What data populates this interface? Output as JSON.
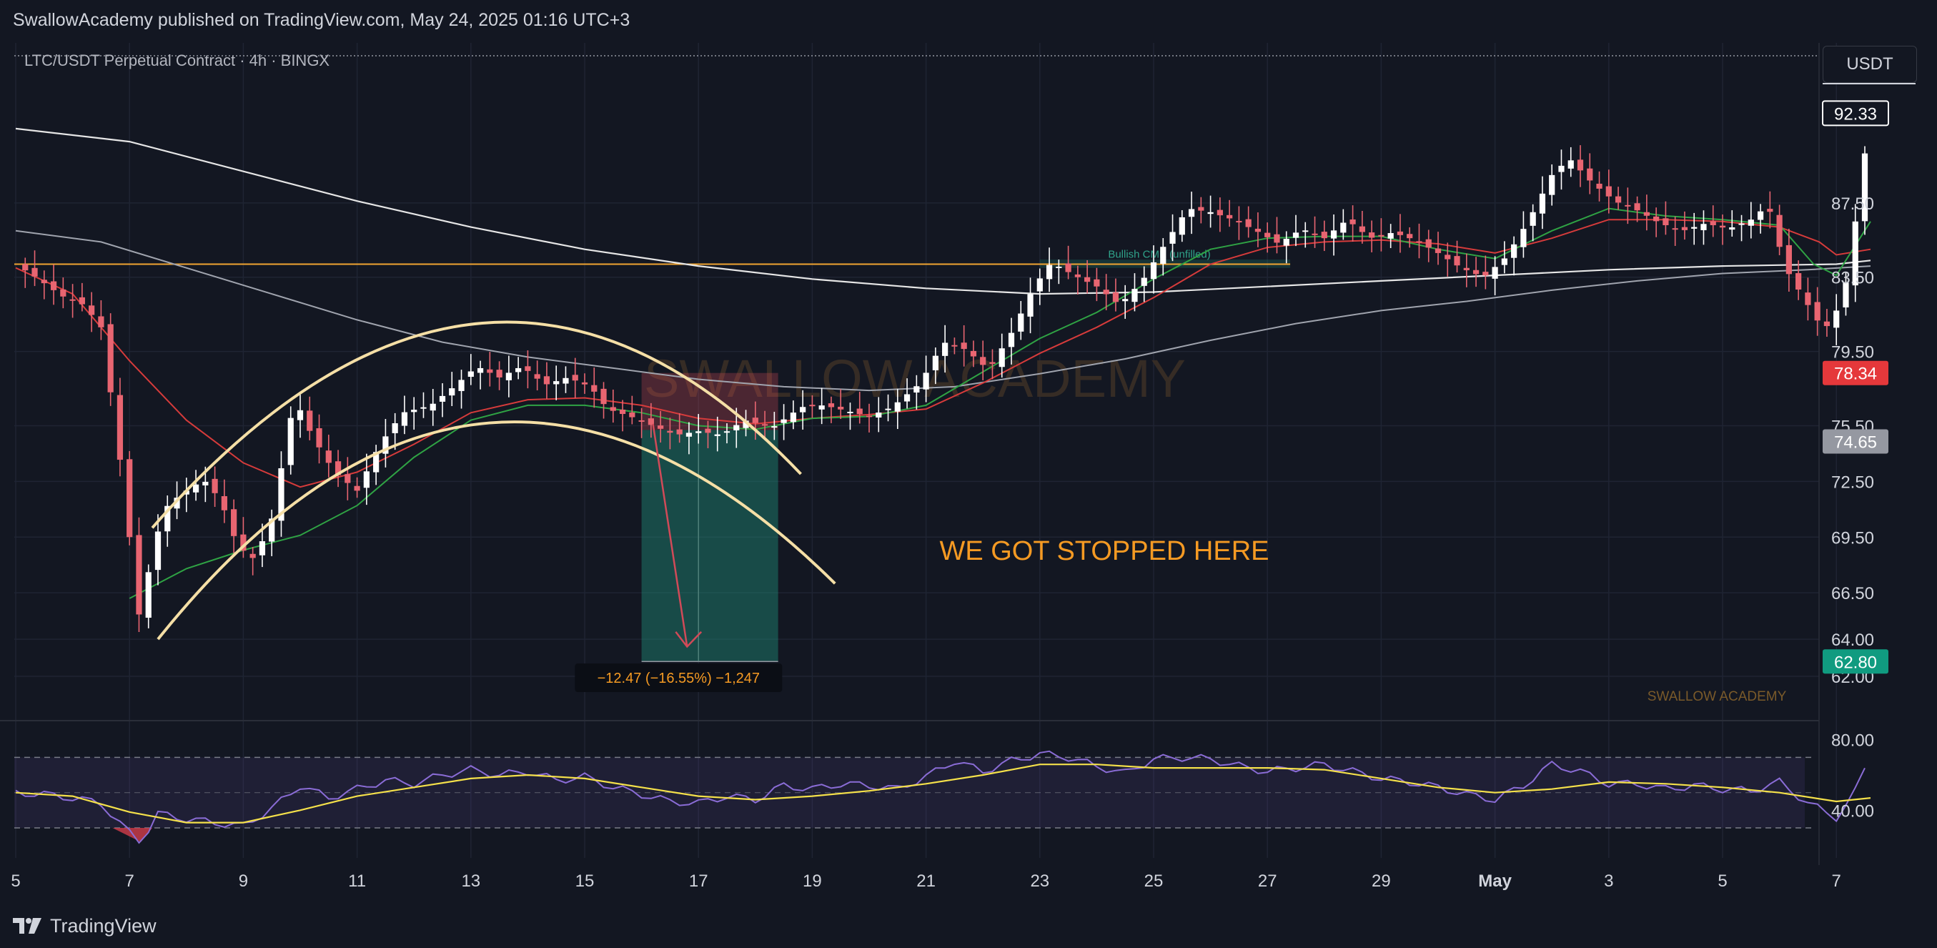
{
  "header": {
    "publisher_line": "SwallowAcademy published on TradingView.com, May 24, 2025 01:16 UTC+3",
    "symbol_line": "LTC/USDT Perpetual Contract · 4h · BINGX",
    "currency_button": "USDT"
  },
  "footer": {
    "brand": "TradingView"
  },
  "colors": {
    "background": "#131722",
    "bull": "#ffffff",
    "bear": "#e86571",
    "ema_fast": "#2fa344",
    "ema_mid": "#d63b3b",
    "ma_slow_1": "#e6e6e6",
    "ma_slow_2": "#a0a4ae",
    "resistance": "#f2a531",
    "rsi": "#8a6cd6",
    "rsi_ma": "#f5e14a",
    "arcs": "#f5dfa6",
    "annotation": "#f59a23",
    "stop_box": "#e0505e",
    "target_box": "#1f8c78"
  },
  "chart_data": {
    "type": "candlestick",
    "timeframe": "4h",
    "x_ticks": [
      "5",
      "7",
      "9",
      "11",
      "13",
      "15",
      "17",
      "19",
      "21",
      "23",
      "25",
      "27",
      "29",
      "May",
      "3",
      "5",
      "7"
    ],
    "price_ticks": [
      87.5,
      83.5,
      79.5,
      75.5,
      72.5,
      69.5,
      66.5,
      64.0,
      62.0
    ],
    "price_ticks_labels": [
      "87.50",
      "83.50",
      "79.50",
      "75.50",
      "72.50",
      "69.50",
      "66.50",
      "64.00",
      "62.00"
    ],
    "price_range": [
      60.5,
      93.5
    ],
    "price_badges": [
      {
        "label": "92.33",
        "value": 92.33,
        "bg": "#131722",
        "fg": "#ffffff",
        "border": "#ffffff"
      },
      {
        "label": "78.34",
        "value": 78.34,
        "bg": "#e5383b",
        "fg": "#ffffff",
        "border": ""
      },
      {
        "label": "74.65",
        "value": 74.65,
        "bg": "#9598a1",
        "fg": "#ffffff",
        "border": ""
      },
      {
        "label": "62.80",
        "value": 62.8,
        "bg": "#109b80",
        "fg": "#ffffff",
        "border": ""
      }
    ],
    "resistance_level": 84.2,
    "close_price": 92.33,
    "annotations": {
      "callout": "WE GOT STOPPED HERE",
      "cme_gap": "Bullish CME (unfilled)",
      "watermark": "SWALLOW ACADEMY",
      "small_brand": "SWALLOW ACADEMY",
      "trade_result": "−12.47 (−16.55%) −1,247"
    },
    "short_position": {
      "entry": 75.27,
      "stop": 78.34,
      "target": 62.8,
      "start_day": 16.0,
      "end_day": 18.4
    },
    "rsi": {
      "ticks": [
        80,
        40
      ],
      "ticks_labels": [
        "80.00",
        "40.00"
      ],
      "upper": 70,
      "lower": 30,
      "range": [
        15,
        90
      ]
    },
    "series_keypoints": {
      "price": [
        [
          5.0,
          84.2
        ],
        [
          5.4,
          83.4
        ],
        [
          5.8,
          82.5
        ],
        [
          6.2,
          82.0
        ],
        [
          6.5,
          80.8
        ],
        [
          6.8,
          74.5
        ],
        [
          7.0,
          69.5
        ],
        [
          7.2,
          64.5
        ],
        [
          7.35,
          68.0
        ],
        [
          7.6,
          71.0
        ],
        [
          7.9,
          71.8
        ],
        [
          8.3,
          72.6
        ],
        [
          8.6,
          71.5
        ],
        [
          8.9,
          69.0
        ],
        [
          9.2,
          68.3
        ],
        [
          9.5,
          70.5
        ],
        [
          9.9,
          77.0
        ],
        [
          10.2,
          75.0
        ],
        [
          10.6,
          73.0
        ],
        [
          11.0,
          72.0
        ],
        [
          11.4,
          74.5
        ],
        [
          11.8,
          76.2
        ],
        [
          12.3,
          76.6
        ],
        [
          12.7,
          77.6
        ],
        [
          13.1,
          78.7
        ],
        [
          13.5,
          78.1
        ],
        [
          13.9,
          78.7
        ],
        [
          14.3,
          77.7
        ],
        [
          14.7,
          78.1
        ],
        [
          15.1,
          77.6
        ],
        [
          15.4,
          76.4
        ],
        [
          15.8,
          76.0
        ],
        [
          16.2,
          75.5
        ],
        [
          16.6,
          75.0
        ],
        [
          17.0,
          75.2
        ],
        [
          17.4,
          75.0
        ],
        [
          17.8,
          75.8
        ],
        [
          18.3,
          75.4
        ],
        [
          18.8,
          76.5
        ],
        [
          19.2,
          76.6
        ],
        [
          19.6,
          76.3
        ],
        [
          20.0,
          76.0
        ],
        [
          20.4,
          76.5
        ],
        [
          20.9,
          77.8
        ],
        [
          21.3,
          80.0
        ],
        [
          21.7,
          79.6
        ],
        [
          22.1,
          78.5
        ],
        [
          22.5,
          80.5
        ],
        [
          22.9,
          83.0
        ],
        [
          23.2,
          84.3
        ],
        [
          23.6,
          83.6
        ],
        [
          24.0,
          83.0
        ],
        [
          24.4,
          82.0
        ],
        [
          24.8,
          83.3
        ],
        [
          25.2,
          85.3
        ],
        [
          25.6,
          87.2
        ],
        [
          26.0,
          87.0
        ],
        [
          26.4,
          86.6
        ],
        [
          26.8,
          86.0
        ],
        [
          27.2,
          85.3
        ],
        [
          27.6,
          86.1
        ],
        [
          28.0,
          85.6
        ],
        [
          28.4,
          86.6
        ],
        [
          28.8,
          85.6
        ],
        [
          29.2,
          85.9
        ],
        [
          29.6,
          85.5
        ],
        [
          30.0,
          84.8
        ],
        [
          30.4,
          84.0
        ],
        [
          30.8,
          83.5
        ],
        [
          31.2,
          84.6
        ],
        [
          31.6,
          86.6
        ],
        [
          32.0,
          89.0
        ],
        [
          32.3,
          89.9
        ],
        [
          32.7,
          88.6
        ],
        [
          33.1,
          87.6
        ],
        [
          33.5,
          87.1
        ],
        [
          33.9,
          86.4
        ],
        [
          34.3,
          86.0
        ],
        [
          34.7,
          86.4
        ],
        [
          35.1,
          86.1
        ],
        [
          35.5,
          86.6
        ],
        [
          35.8,
          87.4
        ],
        [
          36.1,
          84.0
        ],
        [
          36.4,
          82.5
        ],
        [
          36.7,
          81.0
        ],
        [
          36.9,
          80.8
        ],
        [
          37.2,
          83.5
        ],
        [
          37.4,
          88.0
        ],
        [
          37.6,
          92.33
        ]
      ],
      "ema_fast": [
        [
          7.0,
          66.2
        ],
        [
          8.0,
          67.8
        ],
        [
          9.0,
          68.8
        ],
        [
          10.0,
          69.6
        ],
        [
          11.0,
          71.2
        ],
        [
          12.0,
          73.8
        ],
        [
          13.0,
          75.8
        ],
        [
          14.0,
          76.6
        ],
        [
          15.0,
          76.6
        ],
        [
          16.0,
          76.2
        ],
        [
          17.0,
          75.5
        ],
        [
          18.0,
          75.3
        ],
        [
          19.0,
          75.9
        ],
        [
          20.0,
          76.0
        ],
        [
          21.0,
          76.6
        ],
        [
          22.0,
          78.4
        ],
        [
          23.0,
          80.2
        ],
        [
          24.0,
          81.6
        ],
        [
          25.0,
          83.4
        ],
        [
          26.0,
          85.0
        ],
        [
          27.0,
          85.6
        ],
        [
          28.0,
          85.7
        ],
        [
          29.0,
          85.7
        ],
        [
          30.0,
          85.0
        ],
        [
          31.0,
          84.5
        ],
        [
          32.0,
          86.0
        ],
        [
          33.0,
          87.2
        ],
        [
          34.0,
          86.8
        ],
        [
          35.0,
          86.6
        ],
        [
          36.0,
          86.3
        ],
        [
          36.6,
          84.2
        ],
        [
          37.0,
          83.6
        ],
        [
          37.6,
          86.5
        ]
      ],
      "ema_mid": [
        [
          5.0,
          84.0
        ],
        [
          6.0,
          82.6
        ],
        [
          7.0,
          79.0
        ],
        [
          8.0,
          75.8
        ],
        [
          9.0,
          73.5
        ],
        [
          10.0,
          72.2
        ],
        [
          11.0,
          73.0
        ],
        [
          12.0,
          74.5
        ],
        [
          13.0,
          76.2
        ],
        [
          14.0,
          76.9
        ],
        [
          15.0,
          77.0
        ],
        [
          16.0,
          76.6
        ],
        [
          17.0,
          75.9
        ],
        [
          18.0,
          75.6
        ],
        [
          19.0,
          75.9
        ],
        [
          20.0,
          76.1
        ],
        [
          21.0,
          76.4
        ],
        [
          22.0,
          77.8
        ],
        [
          23.0,
          79.4
        ],
        [
          24.0,
          80.8
        ],
        [
          25.0,
          82.4
        ],
        [
          26.0,
          84.2
        ],
        [
          27.0,
          85.1
        ],
        [
          28.0,
          85.4
        ],
        [
          29.0,
          85.5
        ],
        [
          30.0,
          85.3
        ],
        [
          31.0,
          84.8
        ],
        [
          32.0,
          85.6
        ],
        [
          33.0,
          86.6
        ],
        [
          34.0,
          86.6
        ],
        [
          35.0,
          86.5
        ],
        [
          36.0,
          86.2
        ],
        [
          36.7,
          85.4
        ],
        [
          37.0,
          84.7
        ],
        [
          37.6,
          85.0
        ]
      ],
      "ma_slow_1": [
        [
          5.0,
          91.5
        ],
        [
          7.0,
          90.8
        ],
        [
          9.0,
          89.2
        ],
        [
          11.0,
          87.6
        ],
        [
          13.0,
          86.2
        ],
        [
          15.0,
          85.0
        ],
        [
          17.0,
          84.1
        ],
        [
          19.0,
          83.4
        ],
        [
          21.0,
          82.9
        ],
        [
          23.0,
          82.6
        ],
        [
          25.0,
          82.7
        ],
        [
          27.0,
          83.0
        ],
        [
          29.0,
          83.3
        ],
        [
          31.0,
          83.6
        ],
        [
          33.0,
          83.9
        ],
        [
          35.0,
          84.1
        ],
        [
          37.0,
          84.2
        ],
        [
          37.6,
          84.4
        ]
      ],
      "ma_slow_2": [
        [
          5.0,
          86.0
        ],
        [
          6.5,
          85.4
        ],
        [
          8.0,
          84.0
        ],
        [
          9.5,
          82.6
        ],
        [
          11.0,
          81.2
        ],
        [
          12.5,
          80.0
        ],
        [
          14.0,
          79.2
        ],
        [
          15.5,
          78.6
        ],
        [
          17.0,
          78.0
        ],
        [
          18.5,
          77.6
        ],
        [
          20.0,
          77.4
        ],
        [
          21.5,
          77.6
        ],
        [
          23.0,
          78.3
        ],
        [
          24.5,
          79.1
        ],
        [
          26.0,
          80.1
        ],
        [
          27.5,
          81.0
        ],
        [
          29.0,
          81.7
        ],
        [
          30.5,
          82.2
        ],
        [
          32.0,
          82.8
        ],
        [
          33.5,
          83.3
        ],
        [
          35.0,
          83.7
        ],
        [
          36.5,
          83.9
        ],
        [
          37.6,
          84.1
        ]
      ],
      "rsi": [
        [
          5.0,
          50
        ],
        [
          5.5,
          49
        ],
        [
          6.0,
          47
        ],
        [
          6.5,
          44
        ],
        [
          6.9,
          30
        ],
        [
          7.2,
          22
        ],
        [
          7.5,
          38
        ],
        [
          8.0,
          35
        ],
        [
          8.5,
          33
        ],
        [
          9.0,
          31
        ],
        [
          9.5,
          41
        ],
        [
          10.0,
          54
        ],
        [
          10.5,
          47
        ],
        [
          11.0,
          52
        ],
        [
          11.5,
          57
        ],
        [
          12.0,
          55
        ],
        [
          12.5,
          60
        ],
        [
          13.0,
          63
        ],
        [
          13.5,
          60
        ],
        [
          14.0,
          62
        ],
        [
          14.5,
          57
        ],
        [
          15.0,
          59
        ],
        [
          15.5,
          53
        ],
        [
          16.0,
          49
        ],
        [
          16.5,
          45
        ],
        [
          17.0,
          44
        ],
        [
          17.5,
          48
        ],
        [
          18.0,
          46
        ],
        [
          18.5,
          54
        ],
        [
          19.0,
          52
        ],
        [
          19.5,
          55
        ],
        [
          20.0,
          54
        ],
        [
          20.5,
          52
        ],
        [
          21.0,
          59
        ],
        [
          21.5,
          68
        ],
        [
          22.0,
          62
        ],
        [
          22.5,
          68
        ],
        [
          23.0,
          72
        ],
        [
          23.5,
          70
        ],
        [
          24.0,
          65
        ],
        [
          24.5,
          61
        ],
        [
          25.0,
          69
        ],
        [
          25.5,
          70
        ],
        [
          26.0,
          69
        ],
        [
          26.5,
          65
        ],
        [
          27.0,
          62
        ],
        [
          27.5,
          64
        ],
        [
          28.0,
          66
        ],
        [
          28.5,
          62
        ],
        [
          29.0,
          58
        ],
        [
          29.5,
          56
        ],
        [
          30.0,
          53
        ],
        [
          30.5,
          49
        ],
        [
          31.0,
          46
        ],
        [
          31.5,
          54
        ],
        [
          32.0,
          66
        ],
        [
          32.5,
          62
        ],
        [
          33.0,
          55
        ],
        [
          33.5,
          55
        ],
        [
          34.0,
          52
        ],
        [
          34.5,
          54
        ],
        [
          35.0,
          52
        ],
        [
          35.5,
          51
        ],
        [
          36.0,
          56
        ],
        [
          36.5,
          44
        ],
        [
          37.0,
          36
        ],
        [
          37.3,
          48
        ],
        [
          37.6,
          72
        ]
      ],
      "rsi_ma": [
        [
          5.0,
          50
        ],
        [
          6.0,
          48
        ],
        [
          7.0,
          39
        ],
        [
          8.0,
          33
        ],
        [
          9.0,
          33
        ],
        [
          10.0,
          40
        ],
        [
          11.0,
          48
        ],
        [
          12.0,
          53
        ],
        [
          13.0,
          58
        ],
        [
          14.0,
          60
        ],
        [
          15.0,
          58
        ],
        [
          16.0,
          53
        ],
        [
          17.0,
          48
        ],
        [
          18.0,
          46
        ],
        [
          19.0,
          48
        ],
        [
          20.0,
          51
        ],
        [
          21.0,
          55
        ],
        [
          22.0,
          60
        ],
        [
          23.0,
          66
        ],
        [
          24.0,
          66
        ],
        [
          25.0,
          64
        ],
        [
          26.0,
          64
        ],
        [
          27.0,
          64
        ],
        [
          28.0,
          63
        ],
        [
          29.0,
          58
        ],
        [
          30.0,
          53
        ],
        [
          31.0,
          50
        ],
        [
          32.0,
          52
        ],
        [
          33.0,
          56
        ],
        [
          34.0,
          55
        ],
        [
          35.0,
          53
        ],
        [
          36.0,
          50
        ],
        [
          37.0,
          45
        ],
        [
          37.6,
          47
        ]
      ]
    }
  }
}
